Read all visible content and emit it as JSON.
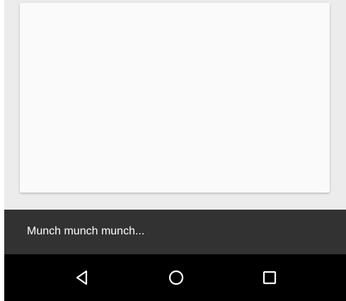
{
  "snackbar": {
    "message": "Munch munch munch..."
  },
  "navigation_bar": {
    "buttons": [
      {
        "name": "back",
        "icon": "back-triangle-icon"
      },
      {
        "name": "home",
        "icon": "home-circle-icon"
      },
      {
        "name": "recents",
        "icon": "recents-square-icon"
      }
    ]
  },
  "colors": {
    "background": "#ececec",
    "card": "#fafafa",
    "snackbar": "#323232",
    "snackbar_text": "#ffffff",
    "navbar": "#000000",
    "nav_icons": "#ffffff"
  }
}
